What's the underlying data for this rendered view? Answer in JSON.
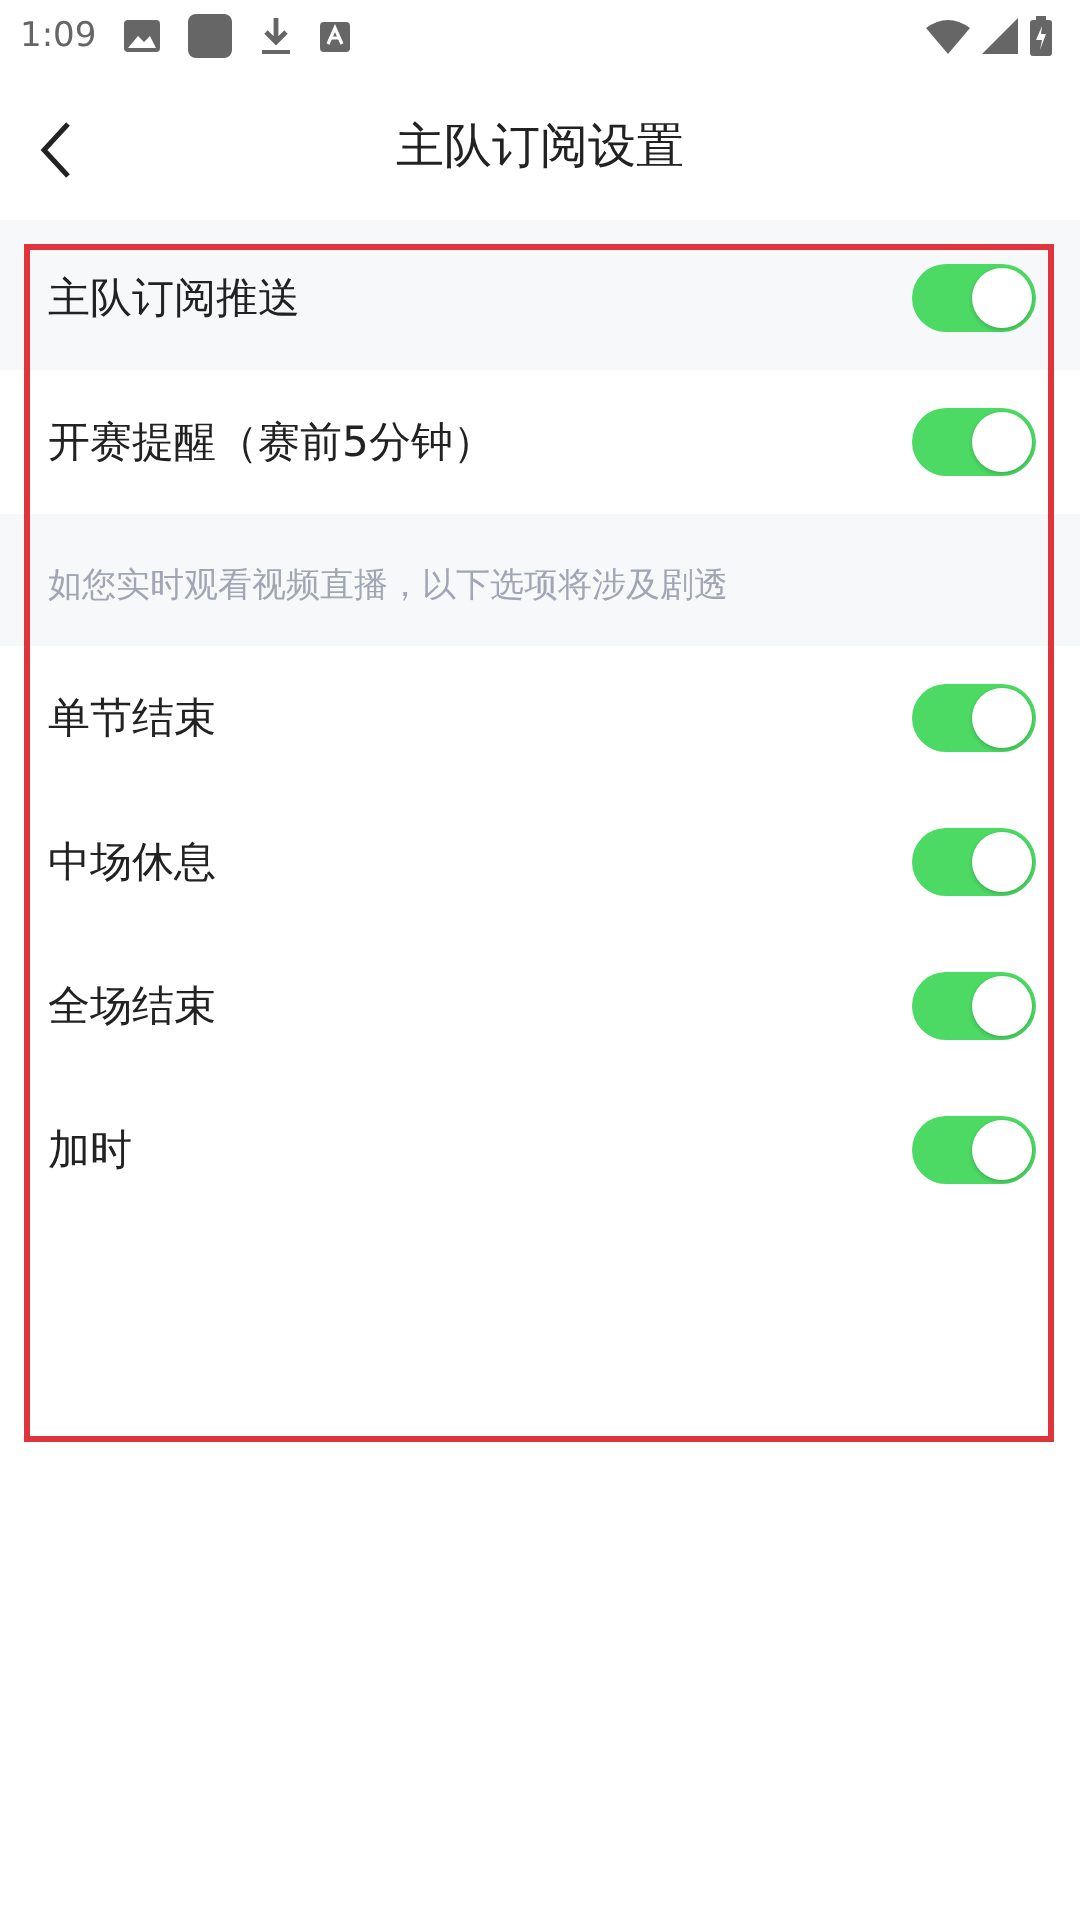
{
  "status_bar": {
    "time": "1:09"
  },
  "header": {
    "title": "主队订阅设置"
  },
  "items": [
    {
      "kind": "master",
      "label": "主队订阅推送",
      "on": true
    },
    {
      "kind": "toggle",
      "label": "开赛提醒（赛前5分钟）",
      "on": true
    },
    {
      "kind": "note",
      "text": "如您实时观看视频直播，以下选项将涉及剧透"
    },
    {
      "kind": "toggle",
      "label": "单节结束",
      "on": true
    },
    {
      "kind": "toggle",
      "label": "中场休息",
      "on": true
    },
    {
      "kind": "toggle",
      "label": "全场结束",
      "on": true
    },
    {
      "kind": "toggle",
      "label": "加时",
      "on": true
    }
  ],
  "highlight": {
    "shown": true
  }
}
